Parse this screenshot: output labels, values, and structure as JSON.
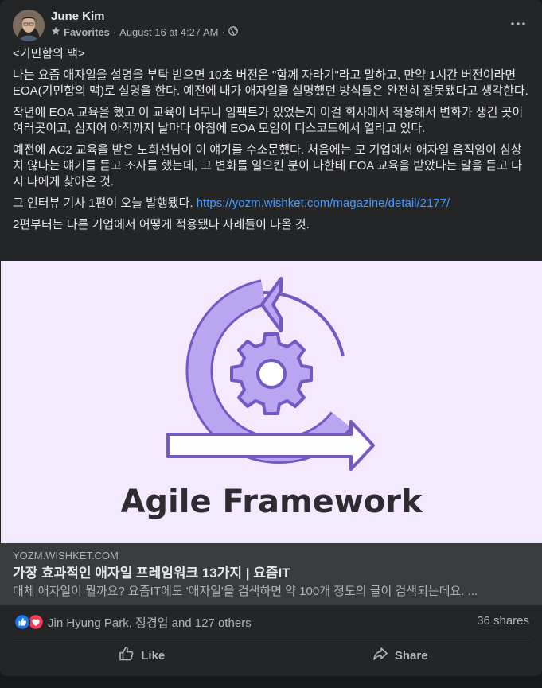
{
  "post": {
    "author": "June Kim",
    "favorites": "Favorites",
    "timestamp": "August 16 at 4:27 AM",
    "separator": "·",
    "audience_icon": "globe-icon",
    "paragraphs": [
      "<기민함의 맥>",
      "나는 요즘 애자일을 설명을 부탁 받으면 10초 버전은 \"함께 자라기\"라고 말하고, 만약 1시간 버전이라면 EOA(기민함의 맥)로 설명을 한다. 예전에 내가 애자일을 설명했던 방식들은 완전히 잘못됐다고 생각한다.",
      "작년에 EOA 교육을 했고 이 교육이 너무나 임팩트가 있었는지 이걸 회사에서 적용해서 변화가 생긴 곳이 여러곳이고, 심지어 아직까지 날마다 아침에 EOA 모임이 디스코드에서 열리고 있다.",
      "예전에 AC2 교육을 받은 노희선님이 이 얘기를 수소문했다. 처음에는 모 기업에서 애자일 움직임이 심상치 않다는 얘기를 듣고 조사를 했는데, 그 변화를 일으킨 분이 나한테 EOA 교육을 받았다는 말을 듣고 다시 나에게 찾아온 것."
    ],
    "interview_text": "그 인터뷰 기사 1편이 오늘 발행됐다. ",
    "interview_link": "https://yozm.wishket.com/magazine/detail/2177/",
    "last_paragraph": "2편부터는 다른 기업에서 어떻게 적용됐나 사례들이 나올 것."
  },
  "preview": {
    "image_caption": "Agile Framework",
    "domain": "YOZM.WISHKET.COM",
    "title": "가장 효과적인 애자일 프레임워크 13가지 | 요즘IT",
    "description": "대체 애자일이 뭘까요? 요즘IT에도 '애자일'을 검색하면 약 100개 정도의 글이 검색되는데요. ..."
  },
  "reactions": {
    "text": "Jin Hyung Park, 정경업 and 127 others",
    "shares": "36 shares",
    "icons": [
      "like-icon",
      "love-icon"
    ]
  },
  "actions": {
    "like_label": "Like",
    "share_label": "Share"
  },
  "colors": {
    "background": "#18191a",
    "card": "#242526",
    "link": "#4599ff",
    "preview_bg": "#f3eaff",
    "like_blue": "#1877f2",
    "love_red": "#f33e58",
    "graphic_purple": "#b9a5f0",
    "graphic_outline": "#7458c4"
  }
}
